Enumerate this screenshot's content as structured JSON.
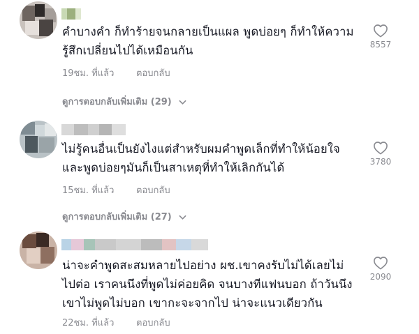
{
  "comments": [
    {
      "text": "คำบางคำ ก็ทำร้ายจนกลายเป็นแผล พูดบ่อยๆ ก็ทำให้ความ\nรู้สึกเปลี่ยนไปได้เหมือนกัน",
      "time": "19ชม. ที่แล้ว",
      "reply_label": "ตอบกลับ",
      "likes": "8557",
      "view_replies": "ดูการตอบกลับเพิ่มเติม (29)"
    },
    {
      "text": "ไม่รู้คนอื่นเป็นยังไงแต่สำหรับผมคำพูดเล็กที่ทำให้น้อยใจ\nและพูดบ่อยๆมันก็เป็นสาเหตุที่ทำให้เลิกกันได้",
      "time": "15ชม. ที่แล้ว",
      "reply_label": "ตอบกลับ",
      "likes": "3780",
      "view_replies": "ดูการตอบกลับเพิ่มเติม (27)"
    },
    {
      "text": "น่าจะคำพูดสะสมหลายไปอย่าง ผช.เขาคงรับไม่ได้เลยไม่\nไปต่อ เราคนนึงที่พูดไม่ค่อยคิด จนบางทีแฟนบอก ถ้าวันนึง\nเขาไม่พูดไม่บอก เขากะจะจากไป น่าจะแนวเดียวกัน",
      "time": "22ชม. ที่แล้ว",
      "reply_label": "ตอบกลับ",
      "likes": "2090"
    }
  ],
  "colors": {
    "text": "#161823",
    "muted": "#8a8b91",
    "divider": "#ececec"
  },
  "icons": {
    "like": "heart-outline-icon",
    "expand": "chevron-down-icon"
  }
}
